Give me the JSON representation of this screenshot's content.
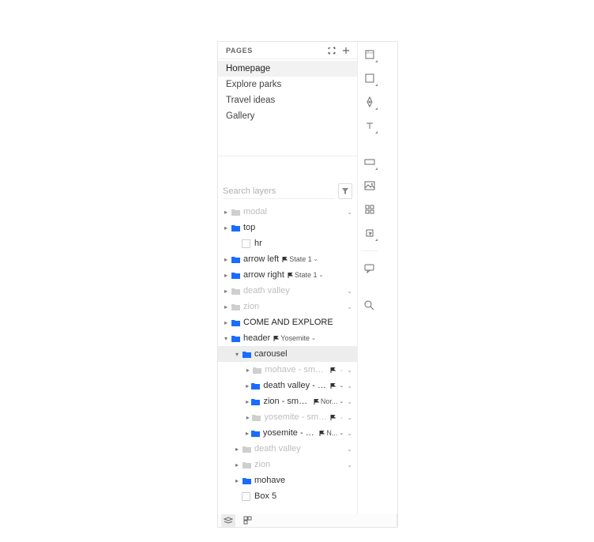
{
  "pages_header": {
    "label": "PAGES"
  },
  "pages": [
    {
      "label": "Homepage",
      "selected": true
    },
    {
      "label": "Explore parks",
      "selected": false
    },
    {
      "label": "Travel ideas",
      "selected": false
    },
    {
      "label": "Gallery",
      "selected": false
    }
  ],
  "search": {
    "placeholder": "Search layers"
  },
  "layers": [
    {
      "indent": 0,
      "muted": true,
      "chev": "right",
      "icon": "folder",
      "label": "modal",
      "trail": "v"
    },
    {
      "indent": 0,
      "muted": false,
      "chev": "right",
      "icon": "folder-blue",
      "label": "top"
    },
    {
      "indent": 1,
      "muted": false,
      "chev": "",
      "icon": "checkbox",
      "label": "hr"
    },
    {
      "indent": 0,
      "muted": false,
      "chev": "right",
      "icon": "folder-blue",
      "label": "arrow left",
      "state": "State 1"
    },
    {
      "indent": 0,
      "muted": false,
      "chev": "right",
      "icon": "folder-blue",
      "label": "arrow right",
      "state": "State 1"
    },
    {
      "indent": 0,
      "muted": true,
      "chev": "right",
      "icon": "folder",
      "label": "death valley",
      "trail": "v"
    },
    {
      "indent": 0,
      "muted": true,
      "chev": "right",
      "icon": "folder",
      "label": "zion",
      "trail": "v"
    },
    {
      "indent": 0,
      "muted": false,
      "chev": "right",
      "icon": "folder-blue",
      "label": "COME AND EXPLORE",
      "bold": true
    },
    {
      "indent": 0,
      "muted": false,
      "chev": "down",
      "icon": "folder-blue",
      "label": "header",
      "state": "Yosemite"
    },
    {
      "indent": 1,
      "muted": false,
      "chev": "down",
      "icon": "folder-blue",
      "label": "carousel",
      "selected": true
    },
    {
      "indent": 2,
      "muted": true,
      "chev": "right",
      "icon": "folder-blue-sm",
      "label": "mohave - smal...",
      "state": "",
      "trail": "v"
    },
    {
      "indent": 2,
      "muted": false,
      "chev": "right",
      "icon": "folder-blue-sm",
      "label": "death valley - smal...",
      "state": "",
      "trail": "v"
    },
    {
      "indent": 2,
      "muted": false,
      "chev": "right",
      "icon": "folder-blue-sm",
      "label": "zion - small b...",
      "state": "Nor...",
      "trail": "v"
    },
    {
      "indent": 2,
      "muted": true,
      "chev": "right",
      "icon": "folder-blue-sm",
      "label": "yosemite - smal...",
      "state": "",
      "trail": "v"
    },
    {
      "indent": 2,
      "muted": false,
      "chev": "right",
      "icon": "folder-blue-sm",
      "label": "yosemite - small ...",
      "state": "N...",
      "trail": "v"
    },
    {
      "indent": 1,
      "muted": true,
      "chev": "right",
      "icon": "folder",
      "label": "death valley",
      "trail": "v"
    },
    {
      "indent": 1,
      "muted": true,
      "chev": "right",
      "icon": "folder",
      "label": "zion",
      "trail": "v"
    },
    {
      "indent": 1,
      "muted": false,
      "chev": "right",
      "icon": "folder-blue",
      "label": "mohave"
    },
    {
      "indent": 1,
      "muted": false,
      "chev": "",
      "icon": "checkbox",
      "label": "Box 5"
    }
  ],
  "right_rail": [
    {
      "name": "frame-tool-icon"
    },
    {
      "name": "square-tool-icon"
    },
    {
      "name": "pen-tool-icon"
    },
    {
      "name": "text-tool-icon"
    },
    {
      "name": "input-tool-icon"
    },
    {
      "name": "image-tool-icon"
    },
    {
      "name": "component-tool-icon"
    },
    {
      "name": "interaction-tool-icon"
    },
    {
      "name": "comment-tool-icon"
    },
    {
      "name": "search-tool-icon"
    }
  ],
  "curly_label": "{$}"
}
